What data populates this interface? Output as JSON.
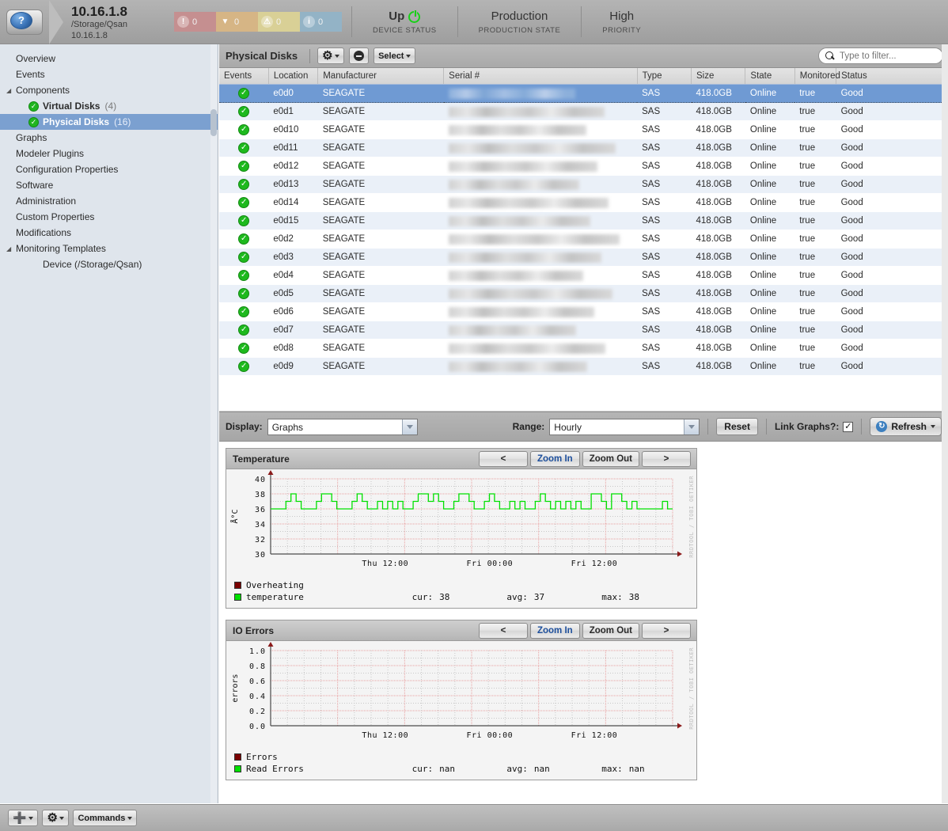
{
  "header": {
    "device_name": "10.16.1.8",
    "device_path": "/Storage/Qsan",
    "device_ip": "10.16.1.8",
    "logo_icon": "disk-device-icon",
    "badges": [
      {
        "icon": "critical-icon",
        "count": "0",
        "color": "#c58f90",
        "glyph": "!"
      },
      {
        "icon": "error-icon",
        "count": "0",
        "color": "#d6b585",
        "glyph": "▼"
      },
      {
        "icon": "warning-icon",
        "count": "0",
        "color": "#d9d096",
        "glyph": "⚠"
      },
      {
        "icon": "info-icon",
        "count": "0",
        "color": "#93b3c6",
        "glyph": "i"
      }
    ],
    "stats": [
      {
        "value": "Up",
        "label": "DEVICE STATUS",
        "icon": "power-icon"
      },
      {
        "value": "Production",
        "label": "PRODUCTION STATE",
        "icon": ""
      },
      {
        "value": "High",
        "label": "PRIORITY",
        "icon": ""
      }
    ]
  },
  "sidebar": {
    "items": [
      {
        "label": "Overview",
        "level": 1,
        "twisty": "",
        "status": "",
        "count": "",
        "bold": false,
        "selected": false
      },
      {
        "label": "Events",
        "level": 1,
        "twisty": "",
        "status": "",
        "count": "",
        "bold": false,
        "selected": false
      },
      {
        "label": "Components",
        "level": 1,
        "twisty": "◢",
        "status": "",
        "count": "",
        "bold": false,
        "selected": false
      },
      {
        "label": "Virtual Disks",
        "level": 2,
        "twisty": "",
        "status": "ok",
        "count": "(4)",
        "bold": true,
        "selected": false
      },
      {
        "label": "Physical Disks",
        "level": 2,
        "twisty": "",
        "status": "ok",
        "count": "(16)",
        "bold": true,
        "selected": true
      },
      {
        "label": "Graphs",
        "level": 1,
        "twisty": "",
        "status": "",
        "count": "",
        "bold": false,
        "selected": false
      },
      {
        "label": "Modeler Plugins",
        "level": 1,
        "twisty": "",
        "status": "",
        "count": "",
        "bold": false,
        "selected": false
      },
      {
        "label": "Configuration Properties",
        "level": 1,
        "twisty": "",
        "status": "",
        "count": "",
        "bold": false,
        "selected": false
      },
      {
        "label": "Software",
        "level": 1,
        "twisty": "",
        "status": "",
        "count": "",
        "bold": false,
        "selected": false
      },
      {
        "label": "Administration",
        "level": 1,
        "twisty": "",
        "status": "",
        "count": "",
        "bold": false,
        "selected": false
      },
      {
        "label": "Custom Properties",
        "level": 1,
        "twisty": "",
        "status": "",
        "count": "",
        "bold": false,
        "selected": false
      },
      {
        "label": "Modifications",
        "level": 1,
        "twisty": "",
        "status": "",
        "count": "",
        "bold": false,
        "selected": false
      },
      {
        "label": "Monitoring Templates",
        "level": 1,
        "twisty": "◢",
        "status": "",
        "count": "",
        "bold": false,
        "selected": false
      },
      {
        "label": "Device (/Storage/Qsan)",
        "level": 3,
        "twisty": "",
        "status": "",
        "count": "",
        "bold": false,
        "selected": false
      }
    ]
  },
  "grid": {
    "title": "Physical Disks",
    "gear_button_label": "",
    "remove_button_label": "",
    "select_button_label": "Select",
    "filter_placeholder": "Type to filter...",
    "filter_value": "",
    "columns": [
      "Events",
      "Location",
      "Manufacturer",
      "Serial #",
      "Type",
      "Size",
      "State",
      "Monitored",
      "Status"
    ],
    "rows": [
      {
        "events": "ok",
        "location": "e0d0",
        "manufacturer": "SEAGATE",
        "serial": "",
        "type": "SAS",
        "size": "418.0GB",
        "state": "Online",
        "monitored": "true",
        "status": "Good",
        "selected": true
      },
      {
        "events": "ok",
        "location": "e0d1",
        "manufacturer": "SEAGATE",
        "serial": "",
        "type": "SAS",
        "size": "418.0GB",
        "state": "Online",
        "monitored": "true",
        "status": "Good",
        "selected": false
      },
      {
        "events": "ok",
        "location": "e0d10",
        "manufacturer": "SEAGATE",
        "serial": "",
        "type": "SAS",
        "size": "418.0GB",
        "state": "Online",
        "monitored": "true",
        "status": "Good",
        "selected": false
      },
      {
        "events": "ok",
        "location": "e0d11",
        "manufacturer": "SEAGATE",
        "serial": "",
        "type": "SAS",
        "size": "418.0GB",
        "state": "Online",
        "monitored": "true",
        "status": "Good",
        "selected": false
      },
      {
        "events": "ok",
        "location": "e0d12",
        "manufacturer": "SEAGATE",
        "serial": "",
        "type": "SAS",
        "size": "418.0GB",
        "state": "Online",
        "monitored": "true",
        "status": "Good",
        "selected": false
      },
      {
        "events": "ok",
        "location": "e0d13",
        "manufacturer": "SEAGATE",
        "serial": "",
        "type": "SAS",
        "size": "418.0GB",
        "state": "Online",
        "monitored": "true",
        "status": "Good",
        "selected": false
      },
      {
        "events": "ok",
        "location": "e0d14",
        "manufacturer": "SEAGATE",
        "serial": "",
        "type": "SAS",
        "size": "418.0GB",
        "state": "Online",
        "monitored": "true",
        "status": "Good",
        "selected": false
      },
      {
        "events": "ok",
        "location": "e0d15",
        "manufacturer": "SEAGATE",
        "serial": "",
        "type": "SAS",
        "size": "418.0GB",
        "state": "Online",
        "monitored": "true",
        "status": "Good",
        "selected": false
      },
      {
        "events": "ok",
        "location": "e0d2",
        "manufacturer": "SEAGATE",
        "serial": "",
        "type": "SAS",
        "size": "418.0GB",
        "state": "Online",
        "monitored": "true",
        "status": "Good",
        "selected": false
      },
      {
        "events": "ok",
        "location": "e0d3",
        "manufacturer": "SEAGATE",
        "serial": "",
        "type": "SAS",
        "size": "418.0GB",
        "state": "Online",
        "monitored": "true",
        "status": "Good",
        "selected": false
      },
      {
        "events": "ok",
        "location": "e0d4",
        "manufacturer": "SEAGATE",
        "serial": "",
        "type": "SAS",
        "size": "418.0GB",
        "state": "Online",
        "monitored": "true",
        "status": "Good",
        "selected": false
      },
      {
        "events": "ok",
        "location": "e0d5",
        "manufacturer": "SEAGATE",
        "serial": "",
        "type": "SAS",
        "size": "418.0GB",
        "state": "Online",
        "monitored": "true",
        "status": "Good",
        "selected": false
      },
      {
        "events": "ok",
        "location": "e0d6",
        "manufacturer": "SEAGATE",
        "serial": "",
        "type": "SAS",
        "size": "418.0GB",
        "state": "Online",
        "monitored": "true",
        "status": "Good",
        "selected": false
      },
      {
        "events": "ok",
        "location": "e0d7",
        "manufacturer": "SEAGATE",
        "serial": "",
        "type": "SAS",
        "size": "418.0GB",
        "state": "Online",
        "monitored": "true",
        "status": "Good",
        "selected": false
      },
      {
        "events": "ok",
        "location": "e0d8",
        "manufacturer": "SEAGATE",
        "serial": "",
        "type": "SAS",
        "size": "418.0GB",
        "state": "Online",
        "monitored": "true",
        "status": "Good",
        "selected": false
      },
      {
        "events": "ok",
        "location": "e0d9",
        "manufacturer": "SEAGATE",
        "serial": "",
        "type": "SAS",
        "size": "418.0GB",
        "state": "Online",
        "monitored": "true",
        "status": "Good",
        "selected": false
      }
    ]
  },
  "graph_controls": {
    "display_label": "Display:",
    "display_value": "Graphs",
    "range_label": "Range:",
    "range_value": "Hourly",
    "reset_label": "Reset",
    "link_graphs_label": "Link Graphs?:",
    "link_graphs_checked": "✓",
    "refresh_label": "Refresh",
    "refresh_icon": "refresh-icon"
  },
  "graph_panel_buttons": {
    "prev": "<",
    "zoom_in": "Zoom In",
    "zoom_out": "Zoom Out",
    "next": ">"
  },
  "rrd_watermark": "RRDTOOL / TOBI OETIKER",
  "chart_data": [
    {
      "type": "line",
      "title": "Temperature",
      "xlabel": "",
      "ylabel": "Å°C",
      "ylim": [
        30,
        40
      ],
      "yticks": [
        "30",
        "32",
        "34",
        "36",
        "38",
        "40"
      ],
      "xticks": [
        "Thu 12:00",
        "Fri 00:00",
        "Fri 12:00"
      ],
      "grid": true,
      "series": [
        {
          "name": "temperature",
          "color": "#00e000",
          "cur": "38",
          "avg": "37",
          "max": "38",
          "values": [
            36,
            36,
            36,
            37,
            38,
            37,
            36,
            36,
            36,
            37,
            38,
            38,
            37,
            36,
            36,
            36,
            37,
            38,
            37,
            36,
            36,
            37,
            36,
            37,
            36,
            37,
            36,
            36,
            37,
            38,
            38,
            37,
            38,
            37,
            36,
            36,
            37,
            38,
            38,
            37,
            36,
            36,
            37,
            38,
            37,
            36,
            36,
            37,
            36,
            37,
            36,
            36,
            37,
            38,
            37,
            36,
            37,
            36,
            37,
            36,
            37,
            36,
            36,
            38,
            38,
            37,
            36,
            38,
            38,
            37,
            36,
            37,
            36,
            36,
            36,
            36,
            36,
            37,
            36,
            36
          ]
        },
        {
          "name": "Overheating",
          "color": "#7a0000",
          "cur": "",
          "avg": "",
          "max": "",
          "values": []
        }
      ]
    },
    {
      "type": "line",
      "title": "IO Errors",
      "xlabel": "",
      "ylabel": "errors",
      "ylim": [
        0.0,
        1.0
      ],
      "yticks": [
        "0.0",
        "0.2",
        "0.4",
        "0.6",
        "0.8",
        "1.0"
      ],
      "xticks": [
        "Thu 12:00",
        "Fri 00:00",
        "Fri 12:00"
      ],
      "grid": true,
      "series": [
        {
          "name": "Read Errors",
          "color": "#00e000",
          "cur": "nan",
          "avg": "nan",
          "max": "nan",
          "values": []
        },
        {
          "name": "Errors",
          "color": "#7a0000",
          "cur": "",
          "avg": "",
          "max": "",
          "values": []
        }
      ]
    }
  ],
  "legend_labels": {
    "cur": "cur:",
    "avg": "avg:",
    "max": "max:"
  },
  "footer": {
    "add_label": "",
    "gear_label": "",
    "commands_label": "Commands"
  }
}
